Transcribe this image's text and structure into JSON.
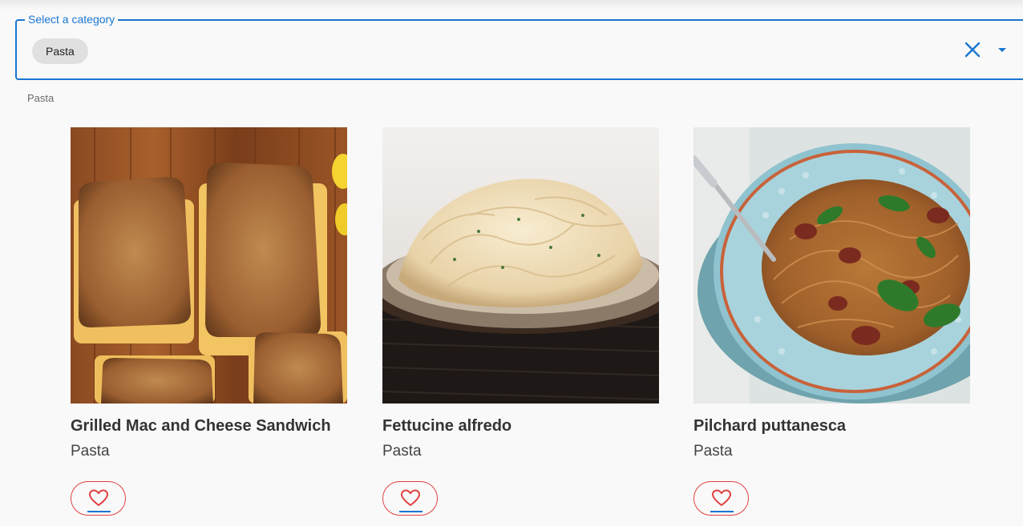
{
  "select": {
    "label": "Select a category",
    "selected_chip": "Pasta",
    "helper_text": "Pasta",
    "clear_icon": "close-icon",
    "dropdown_icon": "arrow-drop-down-icon"
  },
  "colors": {
    "accent": "#1976d2",
    "favorite": "#e04040",
    "chip_bg": "#e0e0e0"
  },
  "recipes": [
    {
      "title": "Grilled Mac and Cheese Sandwich",
      "category": "Pasta",
      "image": "grilled-sandwich-photo"
    },
    {
      "title": "Fettucine alfredo",
      "category": "Pasta",
      "image": "fettucine-photo"
    },
    {
      "title": "Pilchard puttanesca",
      "category": "Pasta",
      "image": "puttanesca-photo"
    }
  ]
}
